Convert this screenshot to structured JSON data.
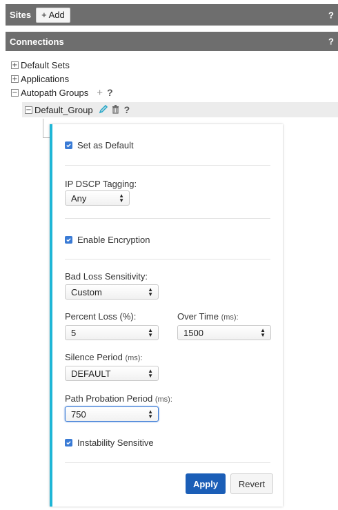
{
  "sites_bar": {
    "title": "Sites",
    "add_label": "+ Add",
    "help": "?"
  },
  "connections_bar": {
    "title": "Connections",
    "help": "?"
  },
  "tree": {
    "items": [
      {
        "expander": "+",
        "label": "Default Sets"
      },
      {
        "expander": "+",
        "label": "Applications"
      },
      {
        "expander": "−",
        "label": "Autopath Groups",
        "add": "+",
        "help": "?"
      }
    ],
    "group": {
      "expander": "−",
      "label": "Default_Group",
      "help": "?"
    }
  },
  "panel": {
    "set_default": {
      "label": "Set as Default",
      "checked": true
    },
    "ip_dscp": {
      "label": "IP DSCP Tagging:",
      "value": "Any"
    },
    "encryption": {
      "label": "Enable Encryption",
      "checked": true
    },
    "bad_loss": {
      "label": "Bad Loss Sensitivity:",
      "value": "Custom"
    },
    "percent_loss": {
      "label": "Percent Loss (%):",
      "value": "5"
    },
    "over_time": {
      "label": "Over Time",
      "unit": "(ms):",
      "value": "1500"
    },
    "silence": {
      "label": "Silence Period",
      "unit": "(ms):",
      "value": "DEFAULT"
    },
    "path_probation": {
      "label": "Path Probation Period",
      "unit": "(ms):",
      "value": "750"
    },
    "instability": {
      "label": "Instability Sensitive",
      "checked": true
    },
    "apply_label": "Apply",
    "revert_label": "Revert"
  },
  "colors": {
    "accent": "#1fb6d6",
    "primary_button": "#1b5eb7",
    "header_bg": "#6e6e6e",
    "checkbox": "#3a7bd5"
  }
}
